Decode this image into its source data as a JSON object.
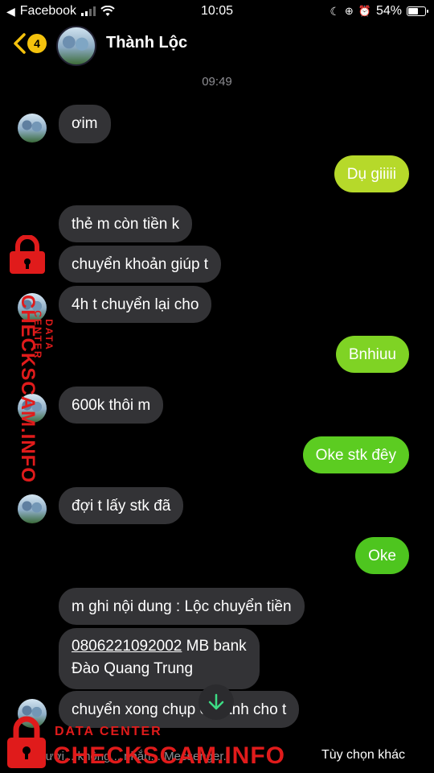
{
  "status_bar": {
    "back_app": "Facebook",
    "time": "10:05",
    "battery": "54%",
    "battery_level": 0.54
  },
  "header": {
    "back_badge": "4",
    "contact_name": "Thành Lộc"
  },
  "timestamp": "09:49",
  "messages": [
    {
      "from": "them",
      "text": "ơim"
    },
    {
      "from": "me",
      "text": "Dụ giiiii"
    },
    {
      "from": "them",
      "text": "thẻ m còn tiền k"
    },
    {
      "from": "them",
      "text": "chuyển khoản giúp t"
    },
    {
      "from": "them",
      "text": "4h t chuyển lại cho"
    },
    {
      "from": "me",
      "text": "Bnhiuu"
    },
    {
      "from": "them",
      "text": "600k thôi m"
    },
    {
      "from": "me",
      "text": "Oke stk đêy"
    },
    {
      "from": "them",
      "text": "đợi t lấy stk đã"
    },
    {
      "from": "me",
      "text": "Oke"
    },
    {
      "from": "them",
      "text": "m ghi nội dung : Lộc chuyển tiền"
    },
    {
      "from": "them",
      "account": "0806221092002",
      "bank": " MB bank",
      "holder": "Đào Quang Trung"
    },
    {
      "from": "them",
      "text": "chuyển xong chụp cái ảnh cho t"
    }
  ],
  "footer": {
    "notice": "người... không... nhắn... Messenger.",
    "action": "Tùy chọn khác"
  },
  "watermark": {
    "label": "DATA CENTER",
    "brand": "CHECKSCAM.INFO"
  },
  "colors": {
    "incoming_bubble": "#333336",
    "outgoing_top": "#b6d92a",
    "outgoing_bottom": "#4ec51f",
    "watermark_red": "#e01b1b",
    "badge_yellow": "#f4c20d"
  }
}
